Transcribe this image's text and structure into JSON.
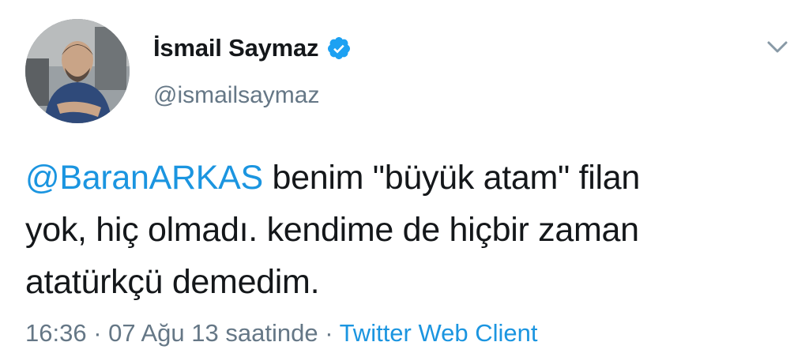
{
  "tweet": {
    "author": {
      "display_name": "İsmail Saymaz",
      "handle": "@ismailsaymaz",
      "verified": true,
      "verified_icon": "verified-badge-icon",
      "avatar_icon": "avatar"
    },
    "menu_icon": "chevron-down-icon",
    "mention": "@BaranARKAS",
    "text_line1_rest": " benim \"büyük atam\" filan",
    "text_line2": "yok, hiç olmadı. kendime de hiçbir zaman",
    "text_line3": "atatürkçü demedim.",
    "timestamp": "16:36 · 07 Ağu 13 saatinde · ",
    "source": "Twitter Web Client"
  },
  "colors": {
    "link": "#1b95e0",
    "secondary_text": "#657786",
    "primary_text": "#14171a",
    "verified": "#1da1f2"
  }
}
